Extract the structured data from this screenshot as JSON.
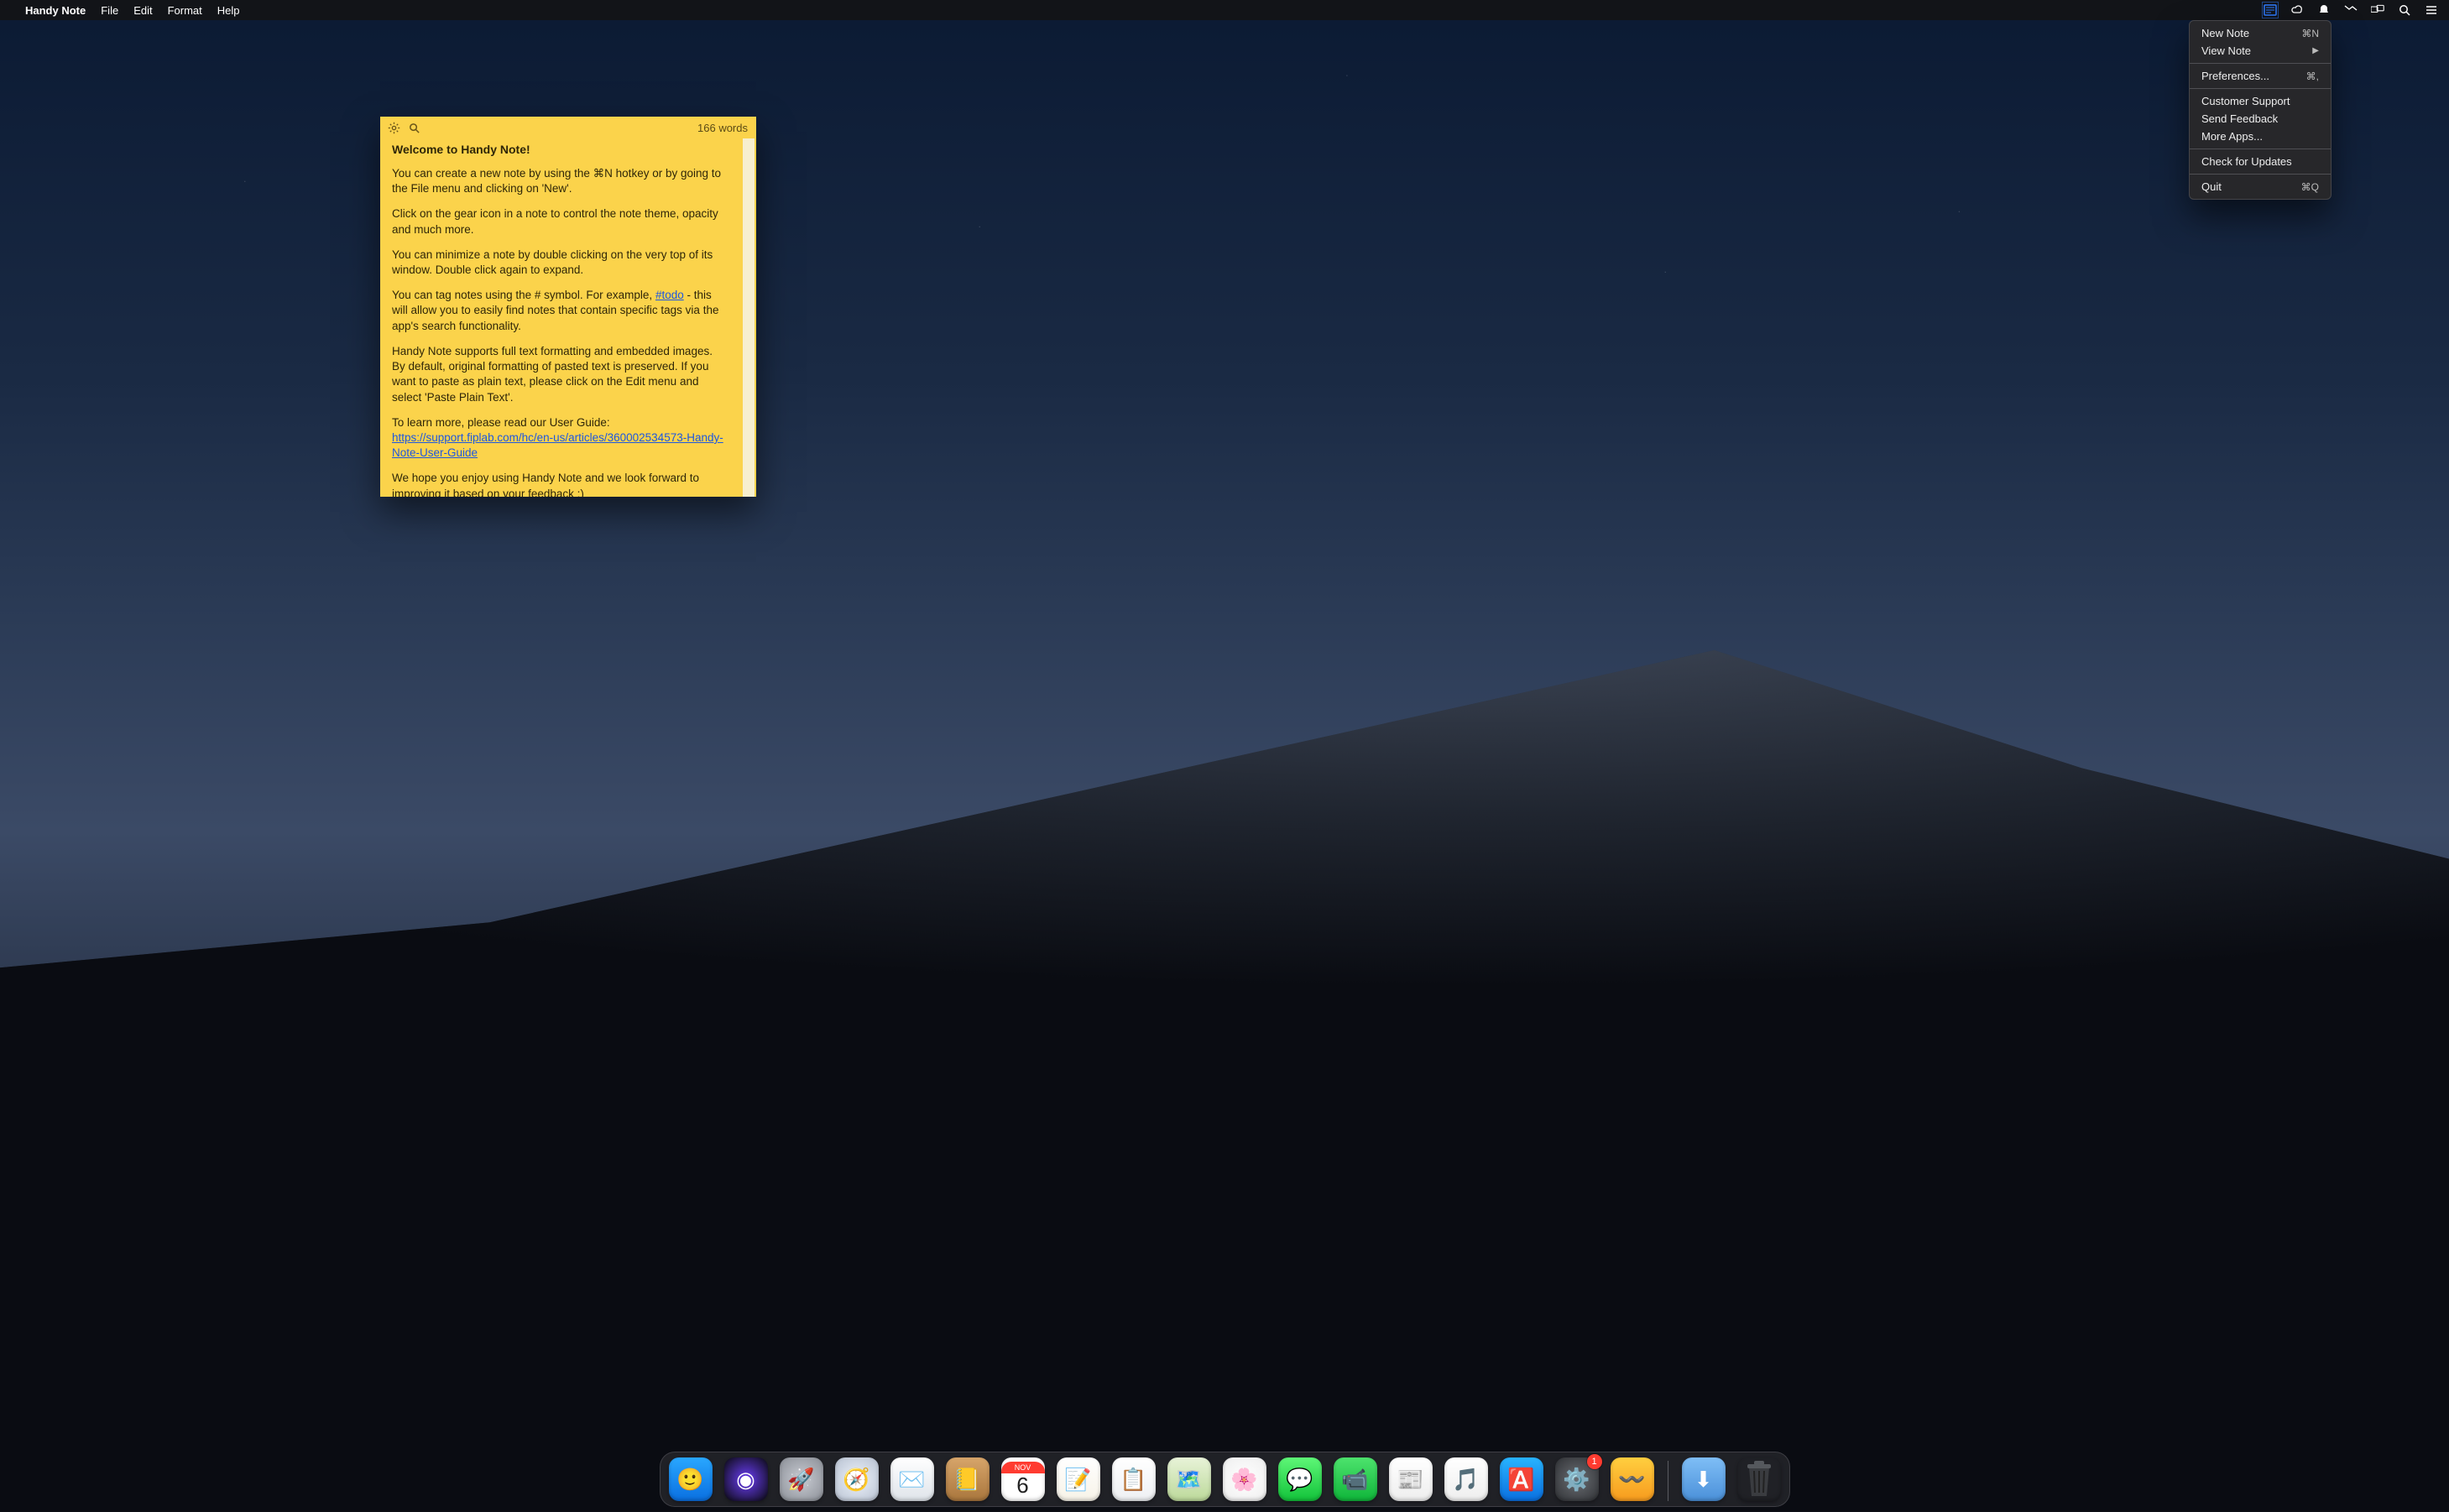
{
  "menubar": {
    "app_name": "Handy Note",
    "items": [
      "File",
      "Edit",
      "Format",
      "Help"
    ]
  },
  "status_icons": [
    "note-app-icon",
    "creative-cloud-icon",
    "notification-bell-icon",
    "airplay-icon",
    "displays-icon",
    "spotlight-search-icon",
    "notification-center-icon"
  ],
  "dropdown": {
    "groups": [
      [
        {
          "label": "New Note",
          "shortcut": "⌘N",
          "submenu": false
        },
        {
          "label": "View Note",
          "shortcut": "",
          "submenu": true
        }
      ],
      [
        {
          "label": "Preferences...",
          "shortcut": "⌘,",
          "submenu": false
        }
      ],
      [
        {
          "label": "Customer Support",
          "shortcut": "",
          "submenu": false
        },
        {
          "label": "Send Feedback",
          "shortcut": "",
          "submenu": false
        },
        {
          "label": "More Apps...",
          "shortcut": "",
          "submenu": false
        }
      ],
      [
        {
          "label": "Check for Updates",
          "shortcut": "",
          "submenu": false
        }
      ],
      [
        {
          "label": "Quit",
          "shortcut": "⌘Q",
          "submenu": false
        }
      ]
    ]
  },
  "note": {
    "word_count": "166 words",
    "title": "Welcome to Handy Note!",
    "p1": "You can create a new note by using the ⌘N hotkey or by going to the File menu and clicking on 'New'.",
    "p2": "Click on the gear icon in a note to control the note theme, opacity and much more.",
    "p3": "You can minimize a note by double clicking on the very top of its window. Double click again to expand.",
    "p4a": "You can tag notes using the # symbol. For example, ",
    "p4_tag": "#todo",
    "p4b": " - this will allow you to easily find notes that contain specific tags via the app's search functionality.",
    "p5": "Handy Note supports full text formatting and embedded images. By default, original formatting of pasted text is preserved. If you want to paste as plain text, please click on the Edit menu and select 'Paste Plain Text'.",
    "p6a": "To learn more, please read our User Guide: ",
    "p6_link": "https://support.fiplab.com/hc/en-us/articles/360002534573-Handy-Note-User-Guide",
    "p7": "We hope you enjoy using Handy Note and we look forward to improving it based on your feedback :)"
  },
  "dock": {
    "calendar": {
      "month": "NOV",
      "day": "6"
    },
    "settings_badge": "1",
    "items": [
      {
        "name": "finder",
        "bg": "linear-gradient(180deg,#29a7ff,#0a6fe0)",
        "glyph": "🙂"
      },
      {
        "name": "siri",
        "bg": "radial-gradient(circle at 50% 50%,#6a3df5,#0a0a0f)",
        "glyph": "◉"
      },
      {
        "name": "launchpad",
        "bg": "radial-gradient(circle,#c9ccd3,#8a8e96)",
        "glyph": "🚀"
      },
      {
        "name": "safari",
        "bg": "radial-gradient(circle,#eef3fb,#b7c1d1)",
        "glyph": "🧭"
      },
      {
        "name": "mail",
        "bg": "linear-gradient(180deg,#fff,#dfe4ea)",
        "glyph": "✉️"
      },
      {
        "name": "contacts",
        "bg": "linear-gradient(180deg,#d7a56a,#a9763d)",
        "glyph": "📒"
      },
      {
        "name": "calendar",
        "bg": "#fff",
        "glyph": ""
      },
      {
        "name": "notes",
        "bg": "linear-gradient(180deg,#fff,#f7f3e8)",
        "glyph": "📝"
      },
      {
        "name": "reminders",
        "bg": "linear-gradient(180deg,#fff,#eef0f3)",
        "glyph": "📋"
      },
      {
        "name": "maps",
        "bg": "linear-gradient(180deg,#e8f3d8,#bcd99a)",
        "glyph": "🗺️"
      },
      {
        "name": "photos",
        "bg": "radial-gradient(circle,#fff,#eee)",
        "glyph": "🌸"
      },
      {
        "name": "messages",
        "bg": "linear-gradient(180deg,#5ef777,#12c33a)",
        "glyph": "💬"
      },
      {
        "name": "facetime",
        "bg": "linear-gradient(180deg,#4de36d,#0fb53a)",
        "glyph": "📹"
      },
      {
        "name": "news",
        "bg": "linear-gradient(180deg,#fff,#eee)",
        "glyph": "📰"
      },
      {
        "name": "itunes",
        "bg": "linear-gradient(180deg,#fff,#eee)",
        "glyph": "🎵"
      },
      {
        "name": "appstore",
        "bg": "linear-gradient(180deg,#28b4ff,#0a6fe0)",
        "glyph": "🅰️"
      },
      {
        "name": "system-preferences",
        "bg": "radial-gradient(circle,#6a6d72,#2f3135)",
        "glyph": "⚙️"
      },
      {
        "name": "other-app",
        "bg": "linear-gradient(180deg,#ffcf3f,#f79b1e)",
        "glyph": "〰️"
      }
    ]
  }
}
